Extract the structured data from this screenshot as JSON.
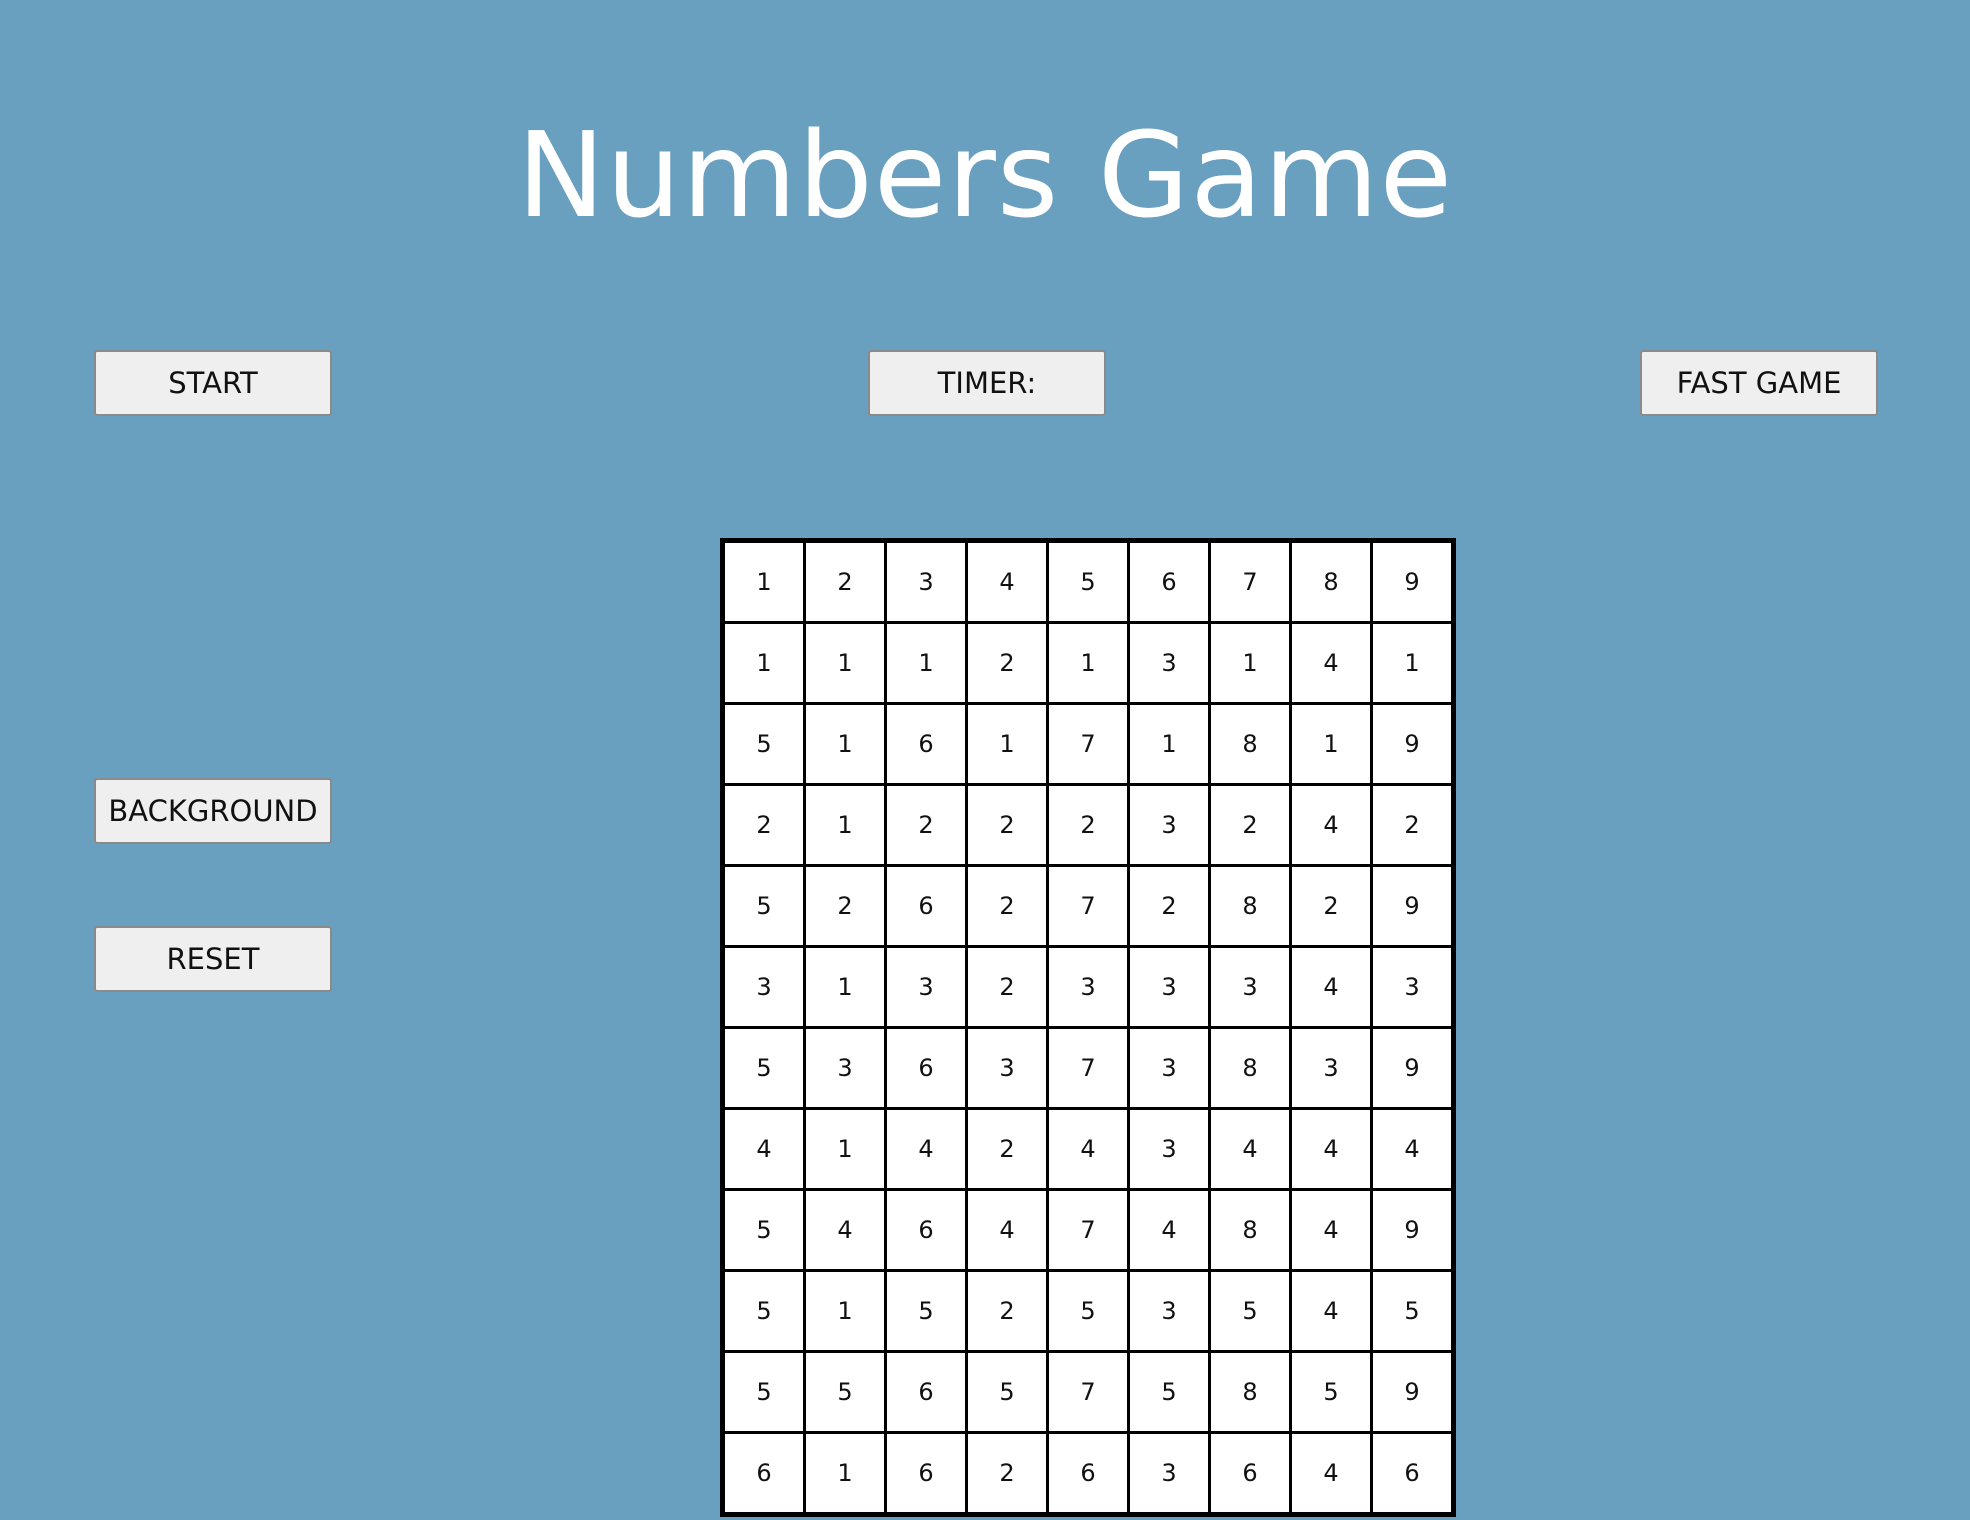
{
  "title": "Numbers Game",
  "buttons": {
    "start": "START",
    "timer": "TIMER:",
    "fast_game": "FAST GAME",
    "background": "BACKGROUND",
    "reset": "RESET"
  },
  "grid": [
    [
      "1",
      "2",
      "3",
      "4",
      "5",
      "6",
      "7",
      "8",
      "9"
    ],
    [
      "1",
      "1",
      "1",
      "2",
      "1",
      "3",
      "1",
      "4",
      "1"
    ],
    [
      "5",
      "1",
      "6",
      "1",
      "7",
      "1",
      "8",
      "1",
      "9"
    ],
    [
      "2",
      "1",
      "2",
      "2",
      "2",
      "3",
      "2",
      "4",
      "2"
    ],
    [
      "5",
      "2",
      "6",
      "2",
      "7",
      "2",
      "8",
      "2",
      "9"
    ],
    [
      "3",
      "1",
      "3",
      "2",
      "3",
      "3",
      "3",
      "4",
      "3"
    ],
    [
      "5",
      "3",
      "6",
      "3",
      "7",
      "3",
      "8",
      "3",
      "9"
    ],
    [
      "4",
      "1",
      "4",
      "2",
      "4",
      "3",
      "4",
      "4",
      "4"
    ],
    [
      "5",
      "4",
      "6",
      "4",
      "7",
      "4",
      "8",
      "4",
      "9"
    ],
    [
      "5",
      "1",
      "5",
      "2",
      "5",
      "3",
      "5",
      "4",
      "5"
    ],
    [
      "5",
      "5",
      "6",
      "5",
      "7",
      "5",
      "8",
      "5",
      "9"
    ],
    [
      "6",
      "1",
      "6",
      "2",
      "6",
      "3",
      "6",
      "4",
      "6"
    ]
  ],
  "colors": {
    "background": "#699fbf",
    "title": "#ffffff",
    "button_bg": "#efefef",
    "cell_bg": "#ffffff",
    "grid_line": "#000000"
  }
}
